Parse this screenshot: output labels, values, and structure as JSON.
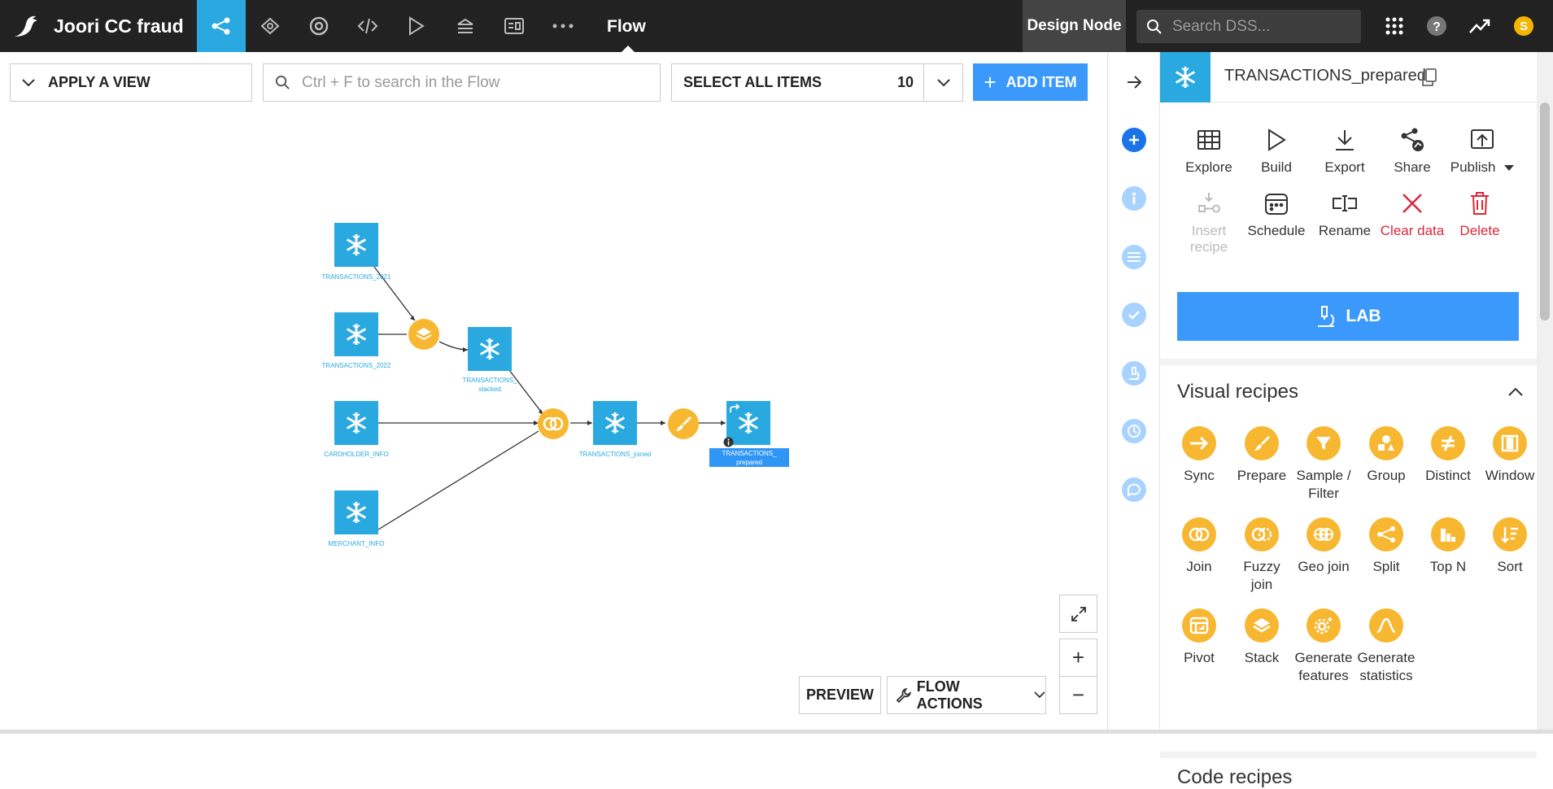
{
  "topbar": {
    "project_name": "Joori CC fraud",
    "section": "Flow",
    "design_node": "Design Node",
    "search_placeholder": "Search DSS...",
    "avatar_letter": "S",
    "nav_icons": [
      "flow-icon",
      "lab-icon",
      "ml-icon",
      "code-icon",
      "run-icon",
      "stack-icon",
      "dashboard-icon",
      "more-icon"
    ]
  },
  "toolbar": {
    "apply_view": "APPLY A VIEW",
    "flow_search_placeholder": "Ctrl + F to search in the Flow",
    "select_all": "SELECT ALL ITEMS",
    "item_count": "10",
    "add_item": "ADD ITEM"
  },
  "flow": {
    "datasets": [
      {
        "name": "TRANSACTIONS_2021"
      },
      {
        "name": "TRANSACTIONS_2022"
      },
      {
        "name": "TRANSACTIONS_stacked"
      },
      {
        "name": "CARDHOLDER_INFO"
      },
      {
        "name": "MERCHANT_INFO"
      },
      {
        "name": "TRANSACTIONS_joined"
      },
      {
        "name": "TRANSACTIONS_prepared"
      }
    ],
    "labels": {
      "t2021": "TRANSACTIONS_2021",
      "t2022": "TRANSACTIONS_2022",
      "stacked_l1": "TRANSACTIONS_",
      "stacked_l2": "stacked",
      "cardholder": "CARDHOLDER_INFO",
      "merchant": "MERCHANT_INFO",
      "joined": "TRANSACTIONS_joined",
      "prepared_l1": "TRANSACTIONS_",
      "prepared_l2": "prepared"
    },
    "recipes": [
      "stack",
      "join",
      "prepare"
    ]
  },
  "flow_controls": {
    "preview": "PREVIEW",
    "flow_actions": "FLOW ACTIONS",
    "zoom_in": "+",
    "zoom_out": "−"
  },
  "panel": {
    "title": "TRANSACTIONS_prepared",
    "actions": {
      "explore": "Explore",
      "build": "Build",
      "export": "Export",
      "share": "Share",
      "publish": "Publish",
      "insert_recipe_1": "Insert",
      "insert_recipe_2": "recipe",
      "schedule": "Schedule",
      "rename": "Rename",
      "clear_data": "Clear data",
      "delete": "Delete"
    },
    "lab": "LAB",
    "visual_recipes_title": "Visual recipes",
    "visual_recipes": {
      "sync": "Sync",
      "prepare": "Prepare",
      "sample_1": "Sample /",
      "sample_2": "Filter",
      "group": "Group",
      "distinct": "Distinct",
      "window": "Window",
      "join": "Join",
      "fuzzy_1": "Fuzzy",
      "fuzzy_2": "join",
      "geo_join": "Geo join",
      "split": "Split",
      "top_n": "Top N",
      "sort": "Sort",
      "pivot": "Pivot",
      "stack": "Stack",
      "genfeat_1": "Generate",
      "genfeat_2": "features",
      "genstat_1": "Generate",
      "genstat_2": "statistics"
    },
    "code_recipes_title": "Code recipes"
  },
  "colors": {
    "topbar_bg": "#222222",
    "accent_blue": "#29a9e0",
    "button_blue": "#3b99fc",
    "recipe_yellow": "#f7b731",
    "danger_red": "#d9283a"
  }
}
